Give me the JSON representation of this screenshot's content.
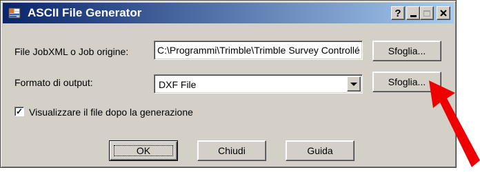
{
  "window": {
    "title": "ASCII File Generator",
    "help_glyph": "?"
  },
  "form": {
    "source_label": "File JobXML o Job origine:",
    "source_value": "C:\\Programmi\\Trimble\\Trimble Survey Controllé",
    "browse_label": "Sfoglia...",
    "format_label": "Formato di output:",
    "format_value": "DXF File",
    "browse2_label": "Sfoglia...",
    "view_label": "Visualizzare il file dopo la generazione",
    "view_checked": true
  },
  "buttons": {
    "ok": "OK",
    "close": "Chiudi",
    "help": "Guida"
  },
  "colors": {
    "titlebar_start": "#0a246a",
    "titlebar_end": "#a6caf0",
    "annotation_arrow": "#ee0000"
  }
}
